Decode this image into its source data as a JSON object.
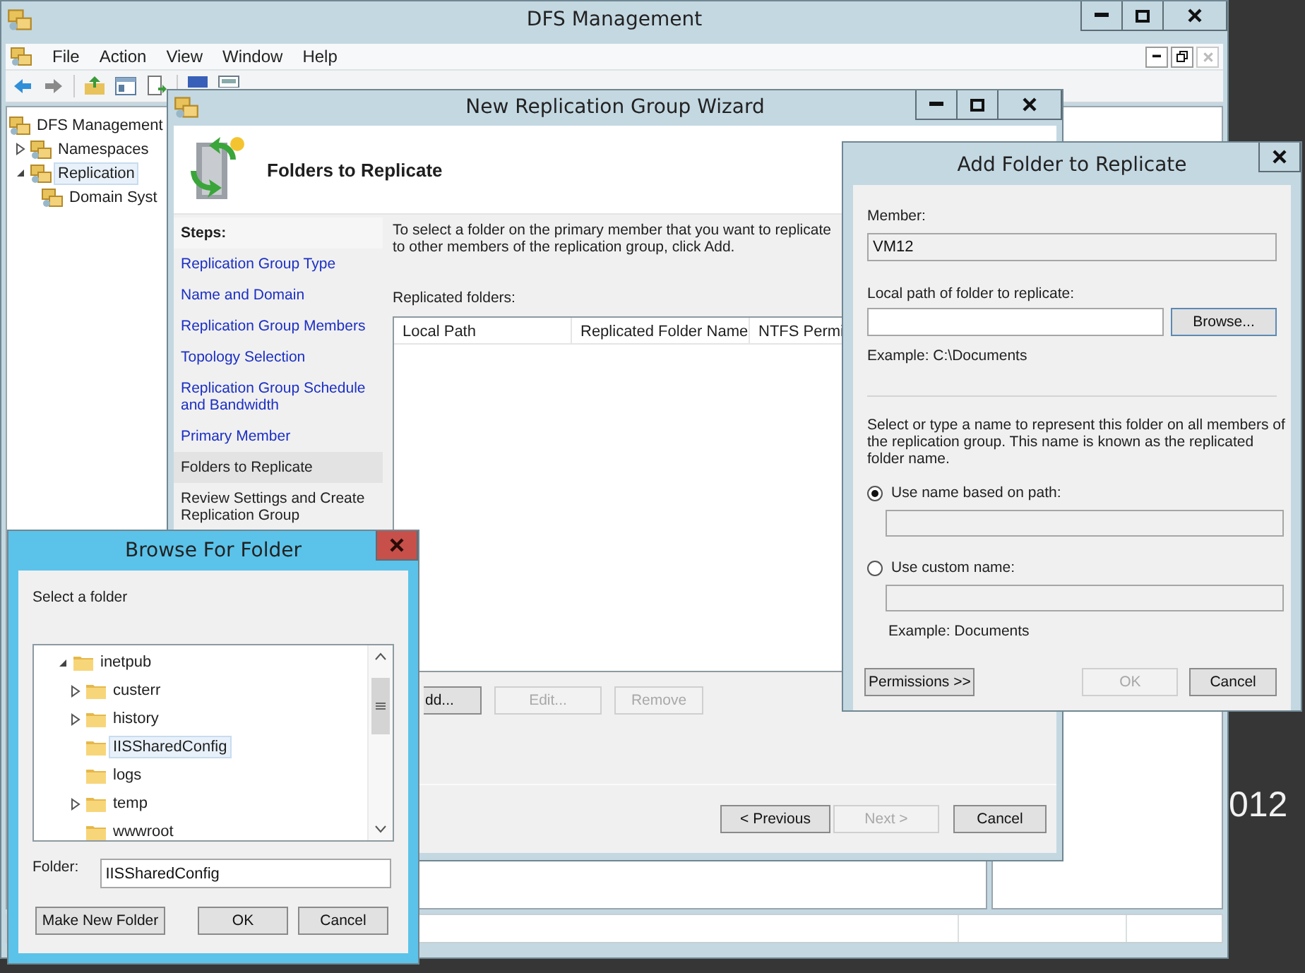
{
  "desktop_text": "012",
  "dfs_window": {
    "title": "DFS Management",
    "menu": [
      "File",
      "Action",
      "View",
      "Window",
      "Help"
    ],
    "tree": [
      {
        "label": "DFS Management",
        "selected": false,
        "children": [
          {
            "label": "Namespaces",
            "expanded": false,
            "selected": false
          },
          {
            "label": "Replication",
            "expanded": true,
            "selected": true,
            "children": [
              {
                "label": "Domain Syst",
                "selected": false
              }
            ]
          }
        ]
      }
    ]
  },
  "wizard": {
    "title": "New Replication Group Wizard",
    "heading": "Folders to Replicate",
    "steps_label": "Steps:",
    "steps": [
      {
        "label": "Replication Group Type",
        "visited": true,
        "selected": false
      },
      {
        "label": "Name and Domain",
        "visited": true,
        "selected": false
      },
      {
        "label": "Replication Group Members",
        "visited": true,
        "selected": false
      },
      {
        "label": "Topology Selection",
        "visited": true,
        "selected": false
      },
      {
        "label": "Replication Group Schedule and Bandwidth",
        "visited": true,
        "selected": false
      },
      {
        "label": "Primary Member",
        "visited": true,
        "selected": false
      },
      {
        "label": "Folders to Replicate",
        "visited": false,
        "selected": true
      },
      {
        "label": "Review Settings and Create Replication Group",
        "visited": false,
        "selected": false
      }
    ],
    "instructions": "To select a folder on the primary member that you want to replicate to other members of the replication group, click Add.",
    "list_label": "Replicated folders:",
    "columns": [
      "Local Path",
      "Replicated Folder Name",
      "NTFS Permi"
    ],
    "list_buttons": [
      {
        "label": "dd...",
        "disabled": false
      },
      {
        "label": "Edit...",
        "disabled": true
      },
      {
        "label": "Remove",
        "disabled": true
      }
    ],
    "nav_buttons": [
      {
        "label": "< Previous",
        "disabled": false
      },
      {
        "label": "Next >",
        "disabled": true
      },
      {
        "label": "Cancel",
        "disabled": false
      }
    ]
  },
  "add_folder_dialog": {
    "title": "Add Folder to Replicate",
    "member_label": "Member:",
    "member_value": "VM12",
    "path_label": "Local path of folder to replicate:",
    "browse_button": "Browse...",
    "path_example": "Example: C:\\Documents",
    "name_instructions": "Select or type a name to represent this folder on all members of the replication group. This name is known as the replicated folder name.",
    "name_options": [
      {
        "label": "Use name based on path:",
        "selected": true
      },
      {
        "label": "Use custom name:",
        "selected": false
      }
    ],
    "name_example": "Example: Documents",
    "buttons": [
      {
        "label": "Permissions >>",
        "disabled": false
      },
      {
        "label": "OK",
        "disabled": true
      },
      {
        "label": "Cancel",
        "disabled": false
      }
    ]
  },
  "browse_dialog": {
    "title": "Browse For Folder",
    "prompt": "Select a folder",
    "tree": [
      {
        "label": "inetpub",
        "expanded": true,
        "selected": false,
        "children": [
          {
            "label": "custerr",
            "expanded": false,
            "selected": false
          },
          {
            "label": "history",
            "expanded": false,
            "selected": false
          },
          {
            "label": "IISSharedConfig",
            "selected": true
          },
          {
            "label": "logs",
            "selected": false
          },
          {
            "label": "temp",
            "expanded": false,
            "selected": false
          },
          {
            "label": "wwwroot",
            "selected": false
          }
        ]
      }
    ],
    "folder_label": "Folder:",
    "folder_value": "IISSharedConfig",
    "buttons": [
      {
        "label": "Make New Folder",
        "disabled": false
      },
      {
        "label": "OK",
        "disabled": false
      },
      {
        "label": "Cancel",
        "disabled": false
      }
    ]
  }
}
